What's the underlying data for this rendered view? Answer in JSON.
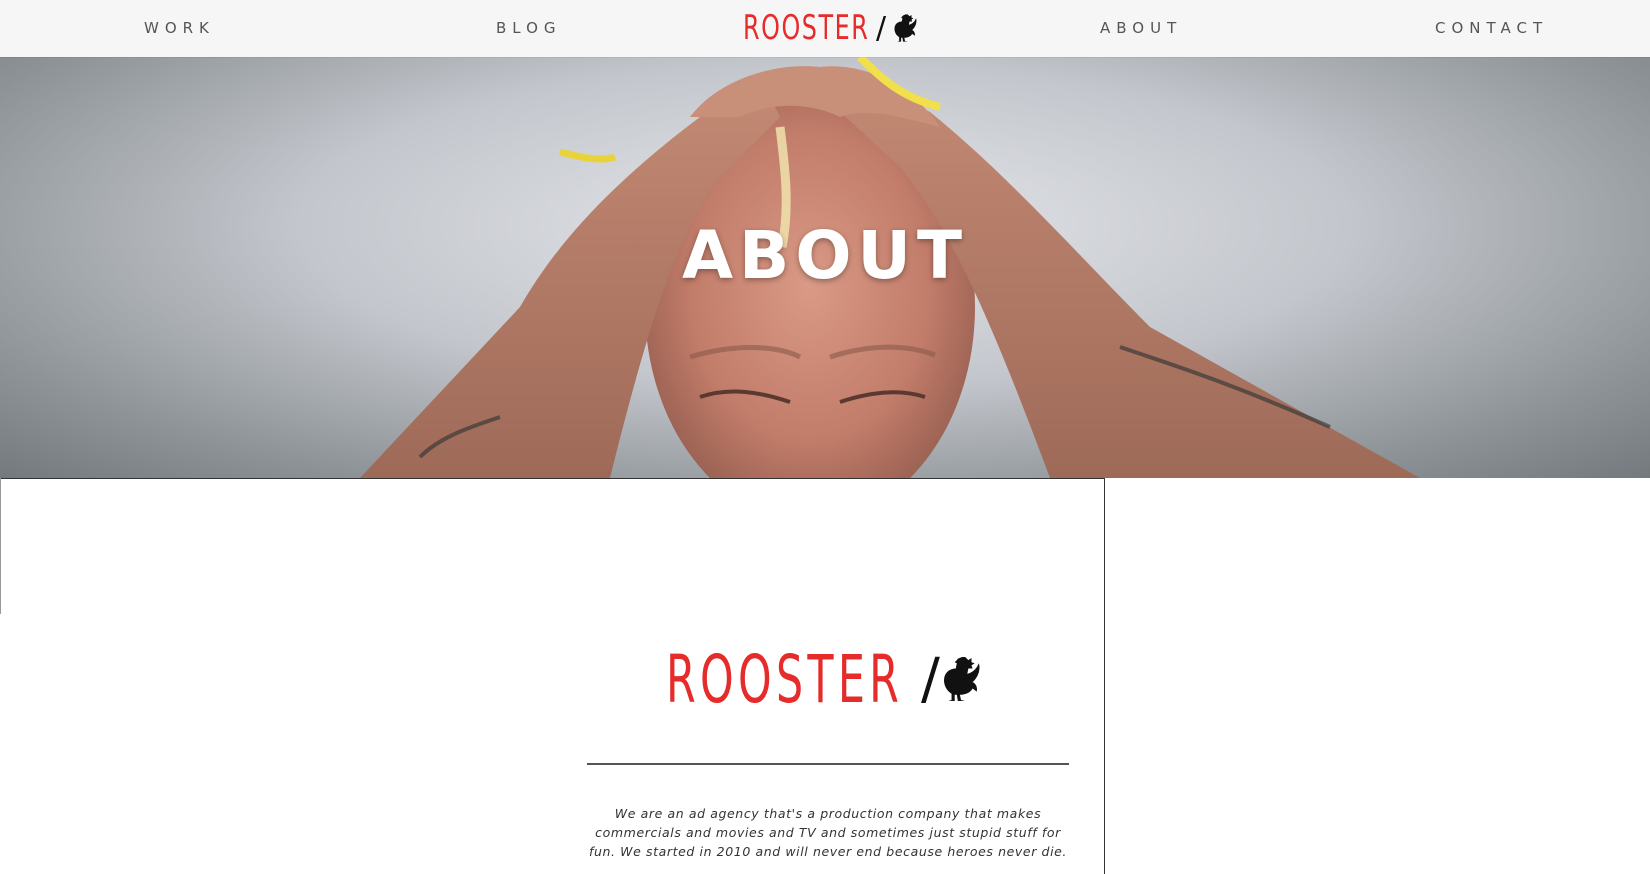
{
  "nav": {
    "work": "WORK",
    "blog": "BLOG",
    "about": "ABOUT",
    "contact": "CONTACT",
    "logo_text": "ROOSTER",
    "logo_slash": "/",
    "logo_icon": "rooster-icon"
  },
  "hero": {
    "title": "ABOUT"
  },
  "content": {
    "logo_text": "ROOSTER",
    "logo_slash": "/",
    "logo_icon": "rooster-icon",
    "description": "We are an ad agency that's a production company that makes commercials and movies and TV and sometimes just stupid stuff for fun. We started in 2010 and will never end because heroes never die."
  },
  "colors": {
    "brand_red": "#e62b2b",
    "text_dark": "#333333",
    "nav_text": "#555555"
  }
}
